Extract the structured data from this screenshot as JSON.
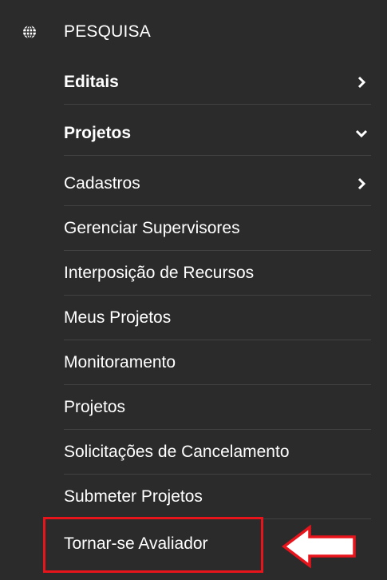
{
  "section": {
    "title": "PESQUISA",
    "icon": "globe-icon"
  },
  "menu": {
    "items": [
      {
        "label": "Editais",
        "bold": true,
        "chevron": "chevron-right-icon"
      },
      {
        "label": "Projetos",
        "bold": true,
        "chevron": "chevron-down-icon"
      },
      {
        "label": "Cadastros",
        "bold": false,
        "chevron": "chevron-right-icon"
      },
      {
        "label": "Gerenciar Supervisores",
        "bold": false,
        "chevron": ""
      },
      {
        "label": "Interposição de Recursos",
        "bold": false,
        "chevron": ""
      },
      {
        "label": "Meus Projetos",
        "bold": false,
        "chevron": ""
      },
      {
        "label": "Monitoramento",
        "bold": false,
        "chevron": ""
      },
      {
        "label": "Projetos",
        "bold": false,
        "chevron": ""
      },
      {
        "label": "Solicitações de Cancelamento",
        "bold": false,
        "chevron": ""
      },
      {
        "label": "Submeter Projetos",
        "bold": false,
        "chevron": ""
      },
      {
        "label": "Tornar-se Avaliador",
        "bold": false,
        "chevron": ""
      }
    ]
  },
  "colors": {
    "background": "#2b2b2b",
    "text": "#ffffff",
    "divider": "#424242",
    "annotation": "#e8141c"
  }
}
